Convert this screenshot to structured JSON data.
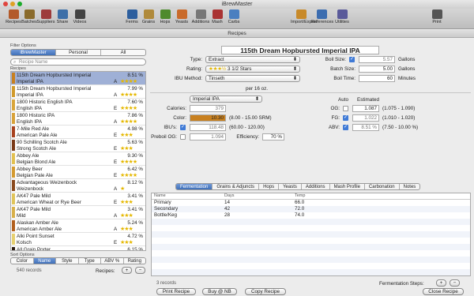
{
  "window": {
    "title": "iBrewMaster",
    "panel_title": "Recipes"
  },
  "toolbar": {
    "items": [
      {
        "label": "Recipes",
        "icon": "book-icon",
        "color": "#b35a2a"
      },
      {
        "label": "Batches",
        "icon": "beer-mug-icon",
        "color": "#8a6b2b"
      },
      {
        "label": "Suppliers",
        "icon": "store-icon",
        "color": "#9d3b3b"
      },
      {
        "label": "Share",
        "icon": "share-icon",
        "color": "#3d6fa8"
      },
      {
        "label": "Videos",
        "icon": "video-icon",
        "color": "#444"
      },
      {
        "label": "Ferms",
        "icon": "calendar-icon",
        "color": "#2d5f9e"
      },
      {
        "label": "Grains",
        "icon": "grain-icon",
        "color": "#b08a3a"
      },
      {
        "label": "Hops",
        "icon": "hop-icon",
        "color": "#4e8a2c"
      },
      {
        "label": "Yeasts",
        "icon": "yeast-icon",
        "color": "#c96a2a"
      },
      {
        "label": "Additions",
        "icon": "additions-icon",
        "color": "#777"
      },
      {
        "label": "Mash",
        "icon": "mash-icon",
        "color": "#a33"
      },
      {
        "label": "Carbs",
        "icon": "carbs-icon",
        "color": "#4a7fc0"
      },
      {
        "label": "Import/Export",
        "icon": "import-export-icon",
        "color": "#c88a2a"
      },
      {
        "label": "References",
        "icon": "references-icon",
        "color": "#3c6db0"
      },
      {
        "label": "Utilities",
        "icon": "utilities-icon",
        "color": "#5a5a9a"
      },
      {
        "label": "Print",
        "icon": "printer-icon",
        "color": "#555"
      }
    ]
  },
  "filter": {
    "label": "Filter Options",
    "segments": [
      "iBrewMaster",
      "Personal",
      "All"
    ],
    "selected": "iBrewMaster",
    "search_placeholder": "Recipe Name",
    "recipes_label": "Recipes"
  },
  "recipes": [
    {
      "name": "115th Dream Hopbursted Imperial",
      "style": "Imperial IPA",
      "abv": "8.51 %",
      "grade": "A",
      "stars": "★★★★",
      "color": "#c8801f",
      "selected": true
    },
    {
      "name": "115th Dream Hopbursted Imperial",
      "style": "Imperial IPA",
      "abv": "7.99 %",
      "grade": "A",
      "stars": "★★★★",
      "color": "#d19a2a",
      "selected": false
    },
    {
      "name": "1800 Historic English IPA",
      "style": "English IPA",
      "abv": "7.60 %",
      "grade": "E",
      "stars": "★★★★",
      "color": "#d9a53a",
      "selected": false
    },
    {
      "name": "1800 Historic IPA",
      "style": "English IPA",
      "abv": "7.86 %",
      "grade": "A",
      "stars": "★★★★",
      "color": "#d8a23a",
      "selected": false
    },
    {
      "name": "7-Mile Red Ale",
      "style": "American Pale Ale",
      "abv": "4.98 %",
      "grade": "E",
      "stars": "★★★",
      "color": "#a8421f",
      "selected": false
    },
    {
      "name": "90 Schilling Scotch Ale",
      "style": "Strong Scotch Ale",
      "abv": "5.63 %",
      "grade": "E",
      "stars": "★★★",
      "color": "#7a3a18",
      "selected": false
    },
    {
      "name": "Abbey Ale",
      "style": "Belgian Blond Ale",
      "abv": "9.30 %",
      "grade": "E",
      "stars": "★★★★",
      "color": "#e2c050",
      "selected": false
    },
    {
      "name": "Abbey Beer",
      "style": "Belgian Pale Ale",
      "abv": "6.42 %",
      "grade": "E",
      "stars": "★★★★",
      "color": "#d49a30",
      "selected": false
    },
    {
      "name": "Advantageous Weizenbock",
      "style": "Weizenbock",
      "abv": "8.12 %",
      "grade": "A",
      "stars": "★",
      "color": "#8a4a1e",
      "selected": false
    },
    {
      "name": "AK47 Pale Mild",
      "style": "American Wheat or Rye Beer",
      "abv": "3.41 %",
      "grade": "E",
      "stars": "★★★",
      "color": "#e0c45a",
      "selected": false
    },
    {
      "name": "AK47 Pale Mild",
      "style": "Mild",
      "abv": "3.41 %",
      "grade": "A",
      "stars": "★★★",
      "color": "#d8b04a",
      "selected": false
    },
    {
      "name": "Alaskan Amber Ale",
      "style": "American Amber Ale",
      "abv": "5.24 %",
      "grade": "A",
      "stars": "★★★",
      "color": "#b2601f",
      "selected": false
    },
    {
      "name": "Alki Point Sunset",
      "style": "Kolsch",
      "abv": "4.72 %",
      "grade": "E",
      "stars": "★★★",
      "color": "#e6d070",
      "selected": false
    },
    {
      "name": "All Grain Porter",
      "style": "American Stout",
      "abv": "6.15 %",
      "grade": "E",
      "stars": "★★★",
      "color": "#2b1a10",
      "selected": false
    }
  ],
  "sort": {
    "label": "Sort Options",
    "options": [
      "Color",
      "Name",
      "Style",
      "Type",
      "ABV %",
      "Rating"
    ],
    "selected": "Name"
  },
  "footer_left": {
    "count": "540 records",
    "recipes_label": "Recipes:",
    "add": "+",
    "remove": "−"
  },
  "detail": {
    "name": "115th Dream Hopbursted Imperial IPA",
    "type_label": "Type:",
    "type": "Extract",
    "rating_label": "Rating:",
    "rating_stars": "★★★½",
    "rating_text": "3 1/2 Stars",
    "ibu_method_label": "IBU Method:",
    "ibu_method": "Tinseth",
    "per": "per 16 oz.",
    "boil_size_label": "Boil Size:",
    "boil_size": "5.57",
    "boil_unit": "Gallons",
    "batch_size_label": "Batch Size:",
    "batch_size": "5.00",
    "batch_unit": "Gallons",
    "boil_time_label": "Boil Time:",
    "boil_time": "60",
    "boil_time_unit": "Minutes",
    "style_label": "Style:",
    "style": "Imperial IPA",
    "calories_label": "Calories:",
    "calories": "379",
    "color_label": "Color:",
    "color_value": "10.30",
    "color_range": "(8.00 - 15.00 SRM)",
    "color_swatch": "#c8801f",
    "ibu_label": "IBU's:",
    "ibu": "118.48",
    "ibu_range": "(60.00 - 120.00)",
    "preboil_label": "Preboil OG:",
    "preboil": "1.094",
    "efficiency_label": "Efficiency:",
    "efficiency": "70 %",
    "auto_label": "Auto",
    "estimated_label": "Estimated",
    "og_label": "OG:",
    "og": "1.087",
    "og_range": "(1.075 - 1.090)",
    "fg_label": "FG:",
    "fg": "1.022",
    "fg_range": "(1.010 - 1.020)",
    "abv_label": "ABV:",
    "abv": "8.51 %",
    "abv_range": "(7.50 - 10.00 %)"
  },
  "tabs": {
    "items": [
      "Fermentation",
      "Grains & Adjuncts",
      "Hops",
      "Yeasts",
      "Additions",
      "Mash Profile",
      "Carbonation",
      "Notes"
    ],
    "selected": "Fermentation"
  },
  "fermentation": {
    "headers": [
      "Name",
      "Days",
      "Temp"
    ],
    "rows": [
      [
        "Primary",
        "14",
        "66.0"
      ],
      [
        "Secondary",
        "42",
        "72.0"
      ],
      [
        "Bottle/Keg",
        "28",
        "74.0"
      ]
    ],
    "count": "3 records",
    "steps_label": "Fermentation Steps:",
    "add": "+",
    "remove": "−"
  },
  "bottom_buttons": {
    "print": "Print Recipe",
    "buy": "Buy @ NB",
    "copy": "Copy Recipe",
    "close": "Close Recipe"
  }
}
